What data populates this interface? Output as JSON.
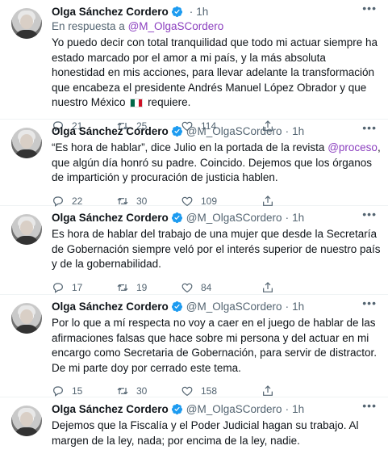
{
  "colors": {
    "accent_mention": "#8b3fbf",
    "verified": "#1d9bf0",
    "muted": "#536471"
  },
  "tweets": [
    {
      "name": "Olga Sánchez Cordero",
      "handle": "",
      "time": "1h",
      "reply_prefix": "En respuesta a ",
      "reply_handle": "@M_OlgaSCordero",
      "text": "Yo puedo decir con total tranquilidad que todo mi actuar siempre ha estado marcado por el amor a mi país, y la más absoluta honestidad en mis acciones, para llevar adelante la transformación que encabeza el presidente Andrés Manuel López Obrador y que nuestro México",
      "text_suffix": " requiere.",
      "replies": "21",
      "retweets": "25",
      "likes": "114"
    },
    {
      "name": "Olga Sánchez Cordero",
      "handle": "@M_OlgaSCordero",
      "time": "1h",
      "text_a": "“Es hora de hablar”, dice Julio en la portada de la revista ",
      "mention": "@proceso",
      "text_b": ", que algún día honró su padre. Coincido. Dejemos que los órganos de impartición y procuración de justicia hablen.",
      "replies": "22",
      "retweets": "30",
      "likes": "109"
    },
    {
      "name": "Olga Sánchez Cordero",
      "handle": "@M_OlgaSCordero",
      "time": "1h",
      "text": "Es hora de hablar del trabajo de una mujer que desde la Secretaría de Gobernación siempre veló por el interés superior de nuestro país y de la gobernabilidad.",
      "replies": "17",
      "retweets": "19",
      "likes": "84"
    },
    {
      "name": "Olga Sánchez Cordero",
      "handle": "@M_OlgaSCordero",
      "time": "1h",
      "text": "Por lo que a mí respecta no voy a caer en el juego de hablar de las afirmaciones falsas que hace sobre mi persona y del actuar en mi encargo como Secretaria de Gobernación, para servir de distractor. De mi parte doy por cerrado este tema.",
      "replies": "15",
      "retweets": "30",
      "likes": "158"
    },
    {
      "name": "Olga Sánchez Cordero",
      "handle": "@M_OlgaSCordero",
      "time": "1h",
      "text": "Dejemos que la Fiscalía y el Poder Judicial hagan su trabajo. Al margen de la ley, nada; por encima de la ley, nadie."
    }
  ]
}
